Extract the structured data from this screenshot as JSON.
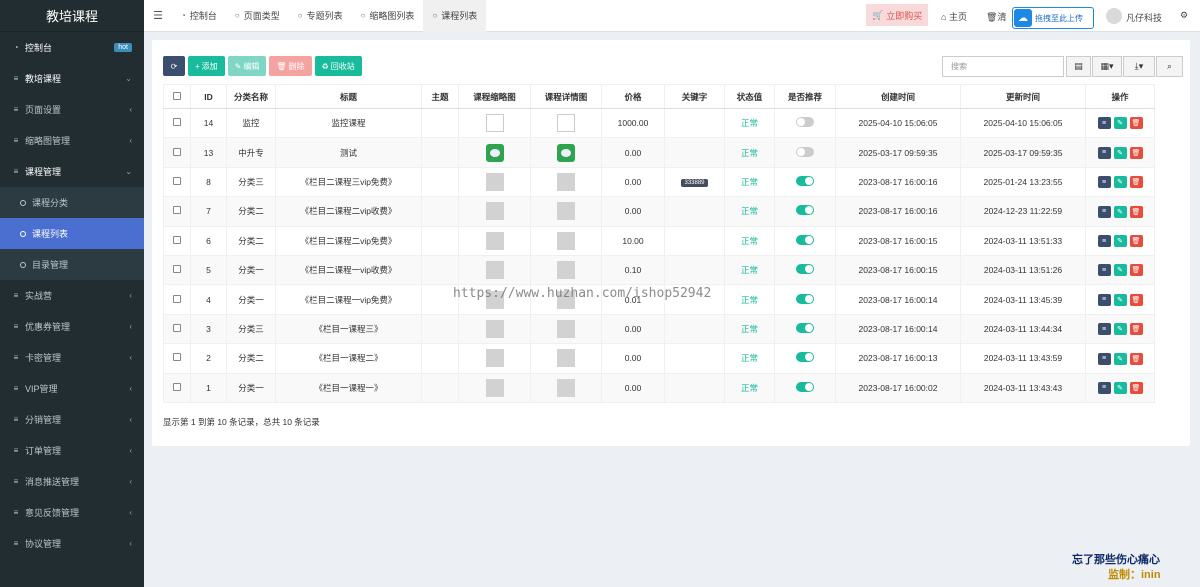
{
  "app": {
    "brand": "教培课程"
  },
  "sidebar": {
    "items": [
      {
        "label": "控制台",
        "icon": "dashboard-icon",
        "badge": "hot",
        "type": "top"
      },
      {
        "label": "教培课程",
        "icon": "list-icon",
        "chev": "⌄",
        "type": "top"
      },
      {
        "label": "页面设置",
        "icon": "list-icon",
        "chev": "‹",
        "type": "normal"
      },
      {
        "label": "缩略图管理",
        "icon": "list-icon",
        "chev": "‹",
        "type": "normal"
      },
      {
        "label": "课程管理",
        "icon": "list-icon",
        "chev": "⌄",
        "type": "top"
      },
      {
        "label": "课程分类",
        "type": "sub"
      },
      {
        "label": "课程列表",
        "type": "sub-active"
      },
      {
        "label": "目录管理",
        "type": "sub"
      },
      {
        "label": "实战营",
        "icon": "list-icon",
        "chev": "‹",
        "type": "normal"
      },
      {
        "label": "优惠券管理",
        "icon": "list-icon",
        "chev": "‹",
        "type": "normal"
      },
      {
        "label": "卡密管理",
        "icon": "list-icon",
        "chev": "‹",
        "type": "normal"
      },
      {
        "label": "VIP管理",
        "icon": "list-icon",
        "chev": "‹",
        "type": "normal"
      },
      {
        "label": "分销管理",
        "icon": "list-icon",
        "chev": "‹",
        "type": "normal"
      },
      {
        "label": "订单管理",
        "icon": "list-icon",
        "chev": "‹",
        "type": "normal"
      },
      {
        "label": "消息推送管理",
        "icon": "list-icon",
        "chev": "‹",
        "type": "normal"
      },
      {
        "label": "意见反馈管理",
        "icon": "list-icon",
        "chev": "‹",
        "type": "normal"
      },
      {
        "label": "协议管理",
        "icon": "list-icon",
        "chev": "‹",
        "type": "normal"
      }
    ]
  },
  "topbar": {
    "tabs": [
      {
        "label": "控制台",
        "icon": "dashboard-icon"
      },
      {
        "label": "页面类型",
        "icon": "circle-icon"
      },
      {
        "label": "专题列表",
        "icon": "circle-icon"
      },
      {
        "label": "缩略图列表",
        "icon": "circle-icon"
      },
      {
        "label": "课程列表",
        "icon": "circle-icon",
        "active": true
      }
    ],
    "buy": "立即购买",
    "home": "主页",
    "clear": "清",
    "upload": "拖拽至此上传",
    "user": "凡仔科技"
  },
  "toolbar": {
    "add": "添加",
    "edit": "编辑",
    "delete": "删除",
    "recycle": "回收站",
    "search_placeholder": "搜索"
  },
  "table": {
    "headers": [
      "",
      "ID",
      "分类名称",
      "标题",
      "主题",
      "课程缩略图",
      "课程详情图",
      "价格",
      "关键字",
      "状态值",
      "是否推荐",
      "创建时间",
      "更新时间",
      "操作"
    ],
    "rows": [
      {
        "id": "14",
        "cat": "监控",
        "title": "监控课程",
        "theme": "",
        "thumb": "broken",
        "detail": "broken",
        "price": "1000.00",
        "kw": "",
        "status": "正常",
        "rec": false,
        "created": "2025-04-10 15:06:05",
        "updated": "2025-04-10 15:06:05"
      },
      {
        "id": "13",
        "cat": "中升专",
        "title": "测试",
        "theme": "",
        "thumb": "green",
        "detail": "green",
        "price": "0.00",
        "kw": "",
        "status": "正常",
        "rec": false,
        "created": "2025-03-17 09:59:35",
        "updated": "2025-03-17 09:59:35"
      },
      {
        "id": "8",
        "cat": "分类三",
        "title": "《栏目二课程三vip免费》",
        "theme": "",
        "thumb": "gray",
        "detail": "gray",
        "price": "0.00",
        "kw": "333889",
        "status": "正常",
        "rec": true,
        "created": "2023-08-17 16:00:16",
        "updated": "2025-01-24 13:23:55"
      },
      {
        "id": "7",
        "cat": "分类二",
        "title": "《栏目二课程二vip收费》",
        "theme": "",
        "thumb": "gray",
        "detail": "gray",
        "price": "0.00",
        "kw": "",
        "status": "正常",
        "rec": true,
        "created": "2023-08-17 16:00:16",
        "updated": "2024-12-23 11:22:59"
      },
      {
        "id": "6",
        "cat": "分类二",
        "title": "《栏目二课程二vip免费》",
        "theme": "",
        "thumb": "gray",
        "detail": "gray",
        "price": "10.00",
        "kw": "",
        "status": "正常",
        "rec": true,
        "created": "2023-08-17 16:00:15",
        "updated": "2024-03-11 13:51:33"
      },
      {
        "id": "5",
        "cat": "分类一",
        "title": "《栏目二课程一vip收费》",
        "theme": "",
        "thumb": "gray",
        "detail": "gray",
        "price": "0.10",
        "kw": "",
        "status": "正常",
        "rec": true,
        "created": "2023-08-17 16:00:15",
        "updated": "2024-03-11 13:51:26"
      },
      {
        "id": "4",
        "cat": "分类一",
        "title": "《栏目二课程一vip免费》",
        "theme": "",
        "thumb": "gray",
        "detail": "gray",
        "price": "0.01",
        "kw": "",
        "status": "正常",
        "rec": true,
        "created": "2023-08-17 16:00:14",
        "updated": "2024-03-11 13:45:39"
      },
      {
        "id": "3",
        "cat": "分类三",
        "title": "《栏目一课程三》",
        "theme": "",
        "thumb": "gray",
        "detail": "gray",
        "price": "0.00",
        "kw": "",
        "status": "正常",
        "rec": true,
        "created": "2023-08-17 16:00:14",
        "updated": "2024-03-11 13:44:34"
      },
      {
        "id": "2",
        "cat": "分类二",
        "title": "《栏目一课程二》",
        "theme": "",
        "thumb": "gray",
        "detail": "gray",
        "price": "0.00",
        "kw": "",
        "status": "正常",
        "rec": true,
        "created": "2023-08-17 16:00:13",
        "updated": "2024-03-11 13:43:59"
      },
      {
        "id": "1",
        "cat": "分类一",
        "title": "《栏目一课程一》",
        "theme": "",
        "thumb": "gray",
        "detail": "gray",
        "price": "0.00",
        "kw": "",
        "status": "正常",
        "rec": true,
        "created": "2023-08-17 16:00:02",
        "updated": "2024-03-11 13:43:43"
      }
    ],
    "summary": "显示第 1 到第 10 条记录，总共 10 条记录"
  },
  "watermark": "https://www.huzhan.com/ishop52942",
  "corner": {
    "line1": "忘了那些伤心痛心",
    "line2": "监制：inin"
  },
  "colors": {
    "accent": "#18bc9c",
    "sidebar": "#222d32",
    "active": "#4a6fd0",
    "danger": "#e74c3c"
  }
}
